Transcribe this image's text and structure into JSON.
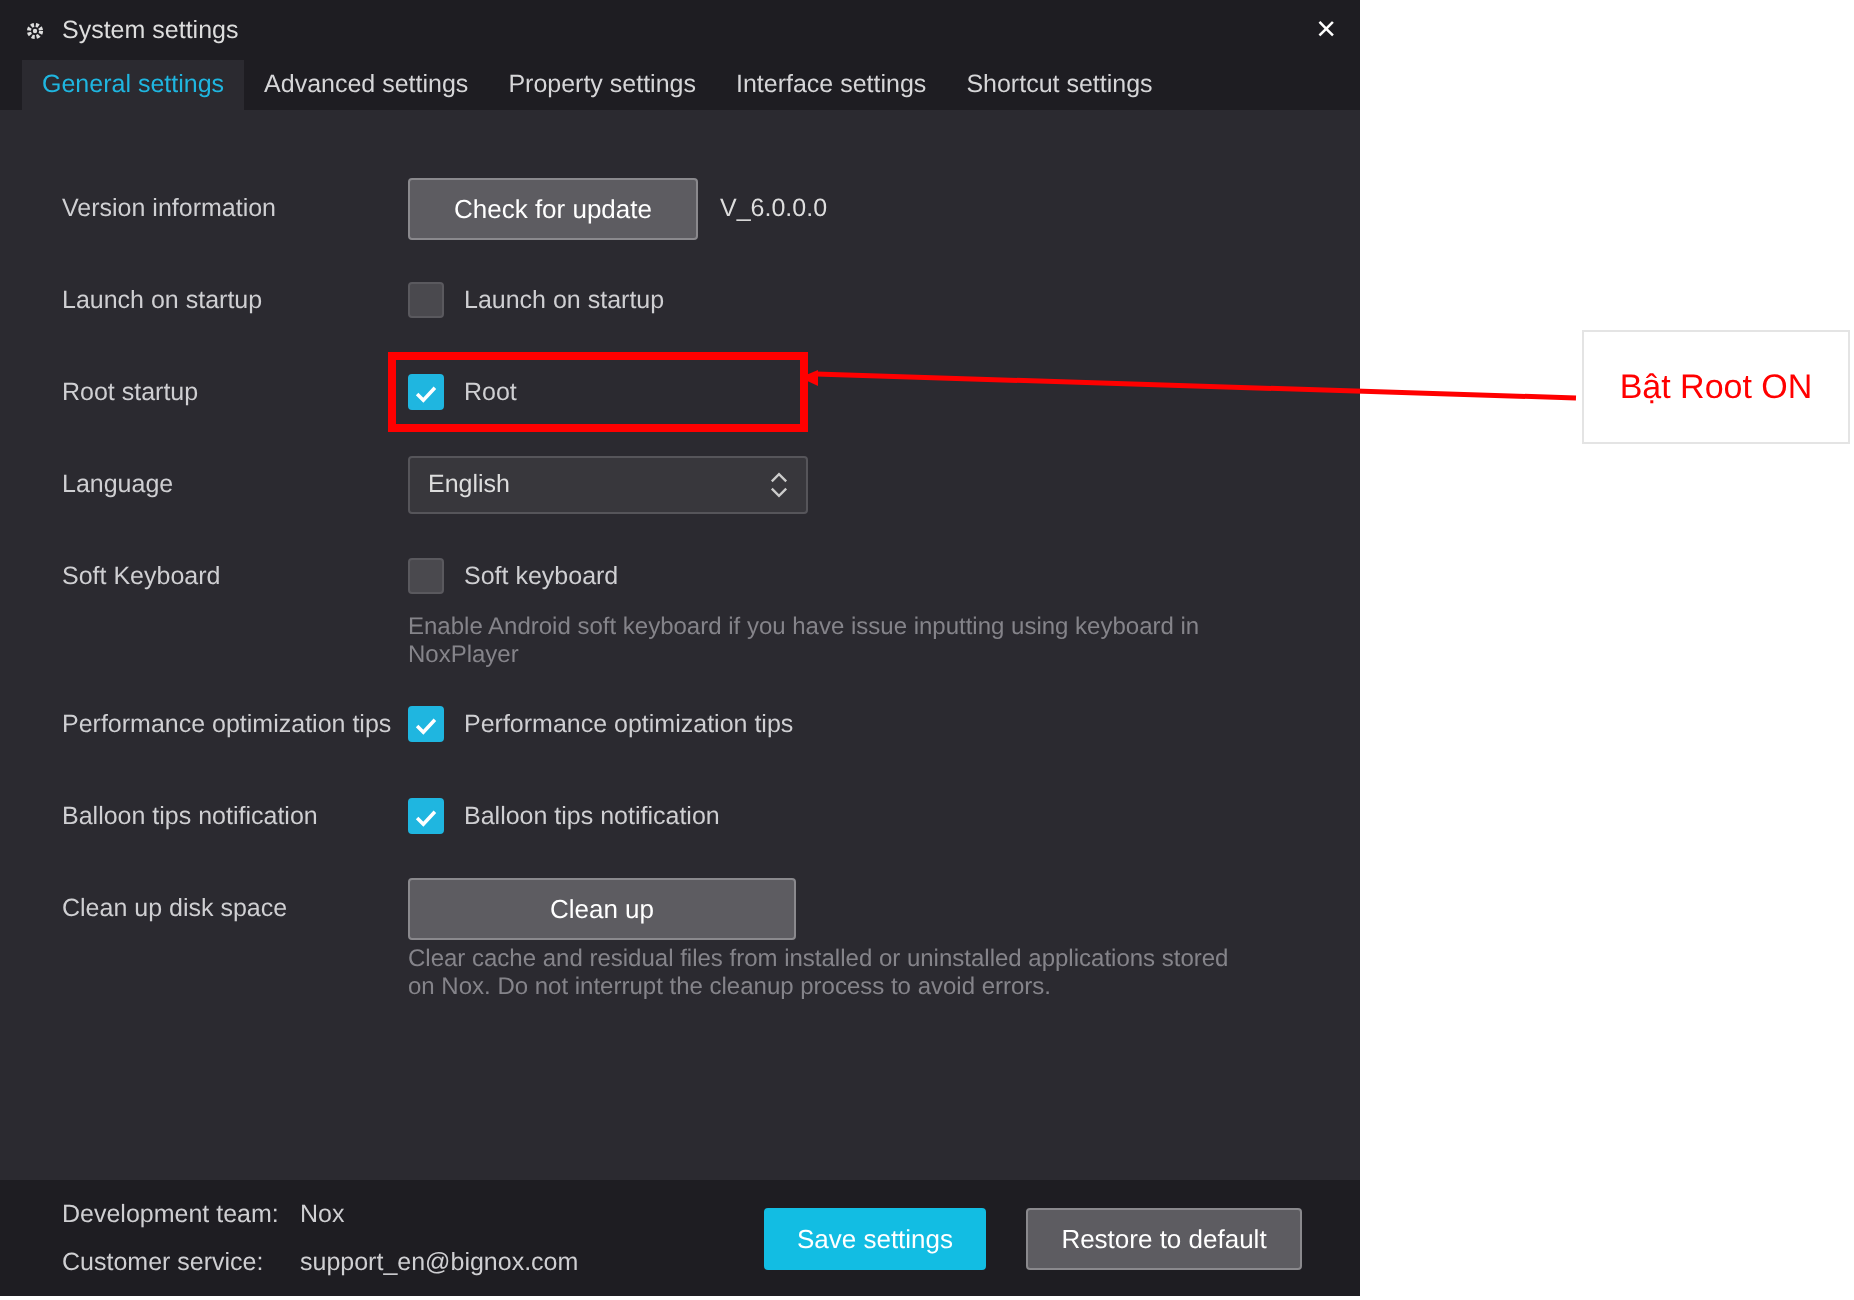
{
  "window": {
    "title": "System settings",
    "close": "×"
  },
  "tabs": [
    {
      "label": "General settings",
      "selected": true
    },
    {
      "label": "Advanced settings",
      "selected": false
    },
    {
      "label": "Property settings",
      "selected": false
    },
    {
      "label": "Interface settings",
      "selected": false
    },
    {
      "label": "Shortcut settings",
      "selected": false
    }
  ],
  "rows": [
    {
      "label": "Version information",
      "kind": "button",
      "button": "Check for update",
      "value": "V_6.0.0.0"
    },
    {
      "label": "Launch on startup",
      "kind": "checkbox",
      "text": "Launch on startup",
      "checked": false
    },
    {
      "label": "Root startup",
      "kind": "checkbox",
      "text": "Root",
      "checked": true,
      "annotated": true
    },
    {
      "label": "Language",
      "kind": "select",
      "value": "English"
    },
    {
      "label": "Soft Keyboard",
      "kind": "checkbox",
      "text": "Soft keyboard",
      "checked": false,
      "hint": "Enable Android soft keyboard if you have issue inputting using keyboard in NoxPlayer"
    },
    {
      "label": "Performance optimization tips",
      "kind": "checkbox",
      "text": "Performance optimization tips",
      "checked": true
    },
    {
      "label": "Balloon tips notification",
      "kind": "checkbox",
      "text": "Balloon tips notification",
      "checked": true
    },
    {
      "label": "Clean up disk space",
      "kind": "wide-button",
      "button": "Clean up",
      "hint": "Clear cache and residual files from installed or uninstalled applications stored on Nox. Do not interrupt the cleanup process to avoid errors."
    }
  ],
  "footer": {
    "info": [
      {
        "label": "Development team:",
        "value": "Nox"
      },
      {
        "label": "Customer service:",
        "value": "support_en@bignox.com"
      }
    ],
    "buttons": [
      {
        "label": "Save settings",
        "primary": true
      },
      {
        "label": "Restore to default",
        "primary": false
      }
    ]
  },
  "annotation": {
    "text": "Bật Root ON"
  }
}
